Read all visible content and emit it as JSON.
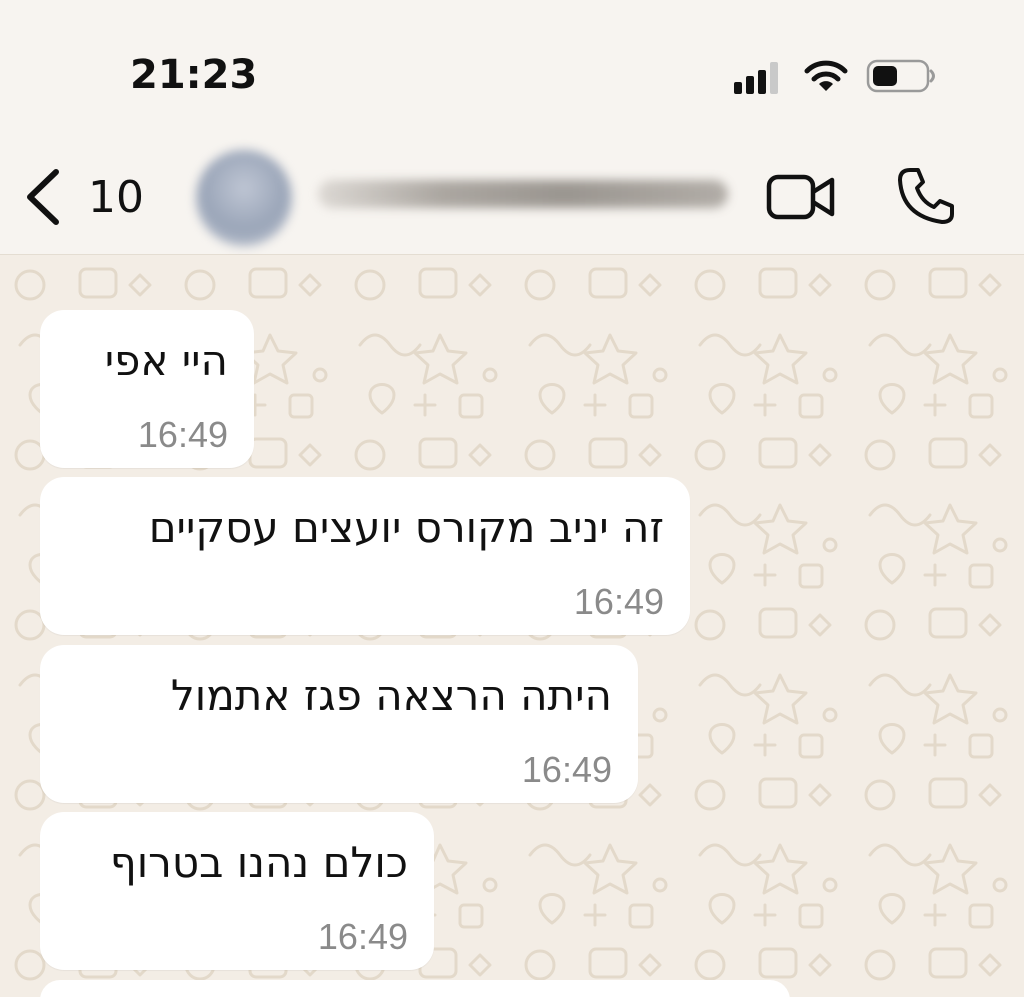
{
  "status_bar": {
    "time": "21:23",
    "icons": [
      "cellular-signal-icon",
      "wifi-icon",
      "battery-icon"
    ]
  },
  "header": {
    "back_count": "10",
    "icons": [
      "chevron-left-icon",
      "video-camera-icon",
      "phone-icon"
    ]
  },
  "messages": [
    {
      "text": "היי אפי",
      "time": "16:49"
    },
    {
      "text": "זה יניב מקורס יועצים עסקיים",
      "time": "16:49"
    },
    {
      "text": "היתה הרצאה פגז אתמול",
      "time": "16:49"
    },
    {
      "text": "כולם נהנו בטרוף",
      "time": "16:49"
    }
  ],
  "colors": {
    "chat_background": "#f3ede5",
    "bubble": "#ffffff",
    "header": "#f7f4f0",
    "timestamp": "#8a8a8a"
  }
}
